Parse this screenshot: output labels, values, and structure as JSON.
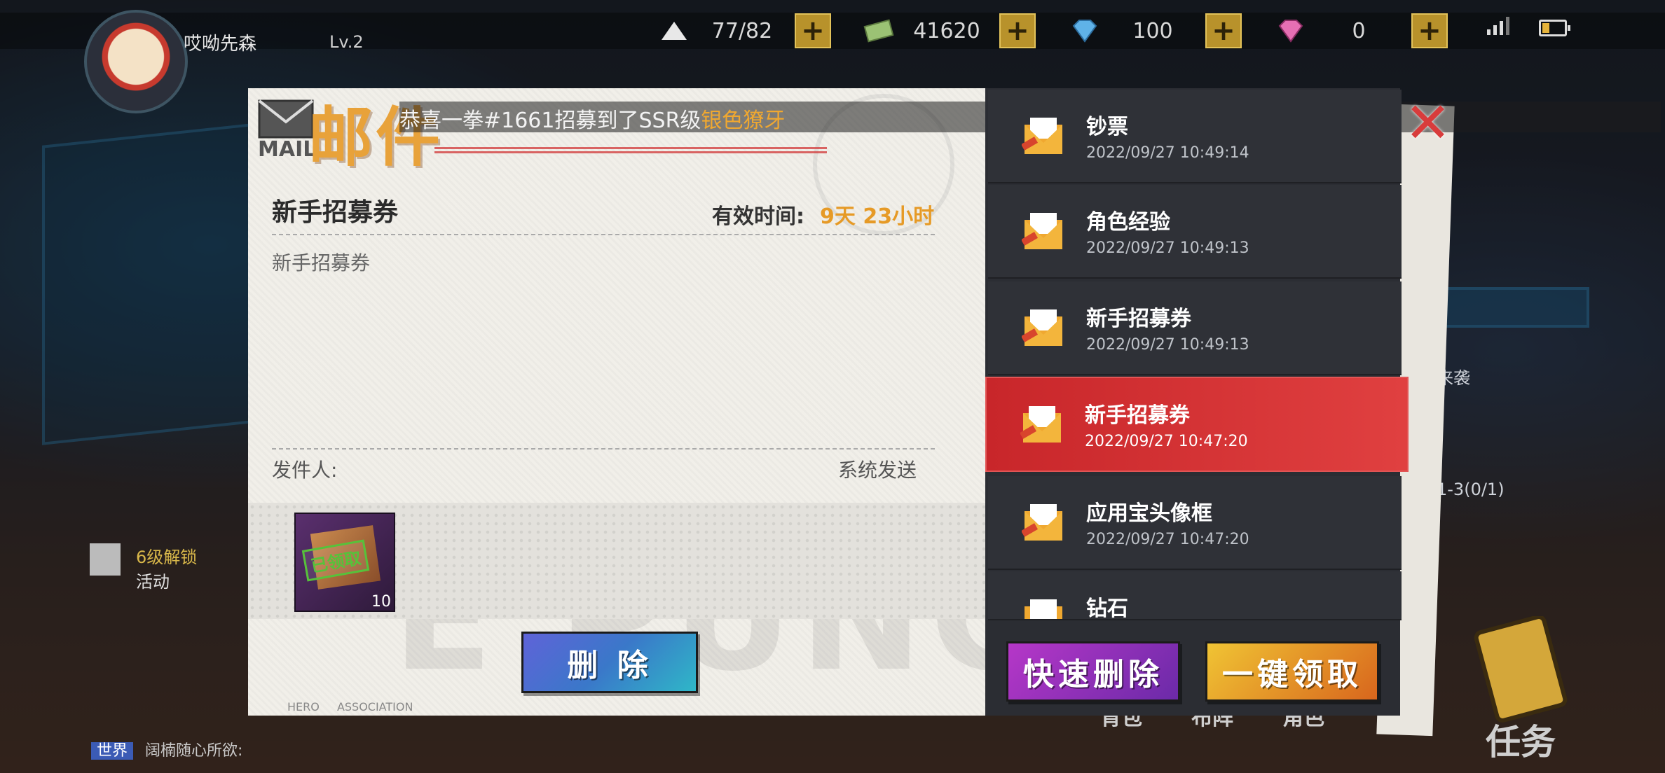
{
  "player": {
    "name": "哎呦先森",
    "level": "Lv.2"
  },
  "resources": [
    {
      "icon": "stamina-icon",
      "value": "77/82"
    },
    {
      "icon": "cash-icon",
      "value": "41620"
    },
    {
      "icon": "diamond-icon",
      "value": "100"
    },
    {
      "icon": "pink-gem-icon",
      "value": "0"
    }
  ],
  "ticker": {
    "prefix": "恭喜一拳#1661招募到了SSR级",
    "highlight": "银色獠牙"
  },
  "mail_window": {
    "title": "邮件",
    "logo_text": "MAIL"
  },
  "detail": {
    "subject": "新手招募券",
    "valid_label": "有效时间:",
    "valid_value": "9天 23小时",
    "body": "新手招募券",
    "sender_label": "发件人:",
    "sender_value": "系统发送",
    "attachment": {
      "status": "已领取",
      "quantity": "10"
    },
    "delete_label": "删 除",
    "footer": "HERO ASSOCIATION",
    "watermark": "E PUNCH"
  },
  "mail_list": [
    {
      "title": "钞票",
      "time": "2022/09/27 10:49:14"
    },
    {
      "title": "角色经验",
      "time": "2022/09/27 10:49:13"
    },
    {
      "title": "新手招募券",
      "time": "2022/09/27 10:49:13"
    },
    {
      "title": "新手招募券",
      "time": "2022/09/27 10:47:20"
    },
    {
      "title": "应用宝头像框",
      "time": "2022/09/27 10:47:20"
    },
    {
      "title": "钻石",
      "time": ""
    }
  ],
  "actions": {
    "quick_delete": "快速删除",
    "claim_all": "一键领取"
  },
  "background": {
    "gift": {
      "unlock": "6级解锁",
      "label": "活动"
    },
    "chat": {
      "tag": "世界",
      "text": "阔楠随心所欲:"
    },
    "nav": [
      "背包",
      "布阵",
      "角色"
    ],
    "task_label": "任务",
    "side_text": "来袭",
    "side_progress": "1-3(0/1)"
  },
  "colors": {
    "accent_orange": "#e69a26",
    "active_red": "#d83333",
    "panel_dark": "#2b2d33"
  }
}
